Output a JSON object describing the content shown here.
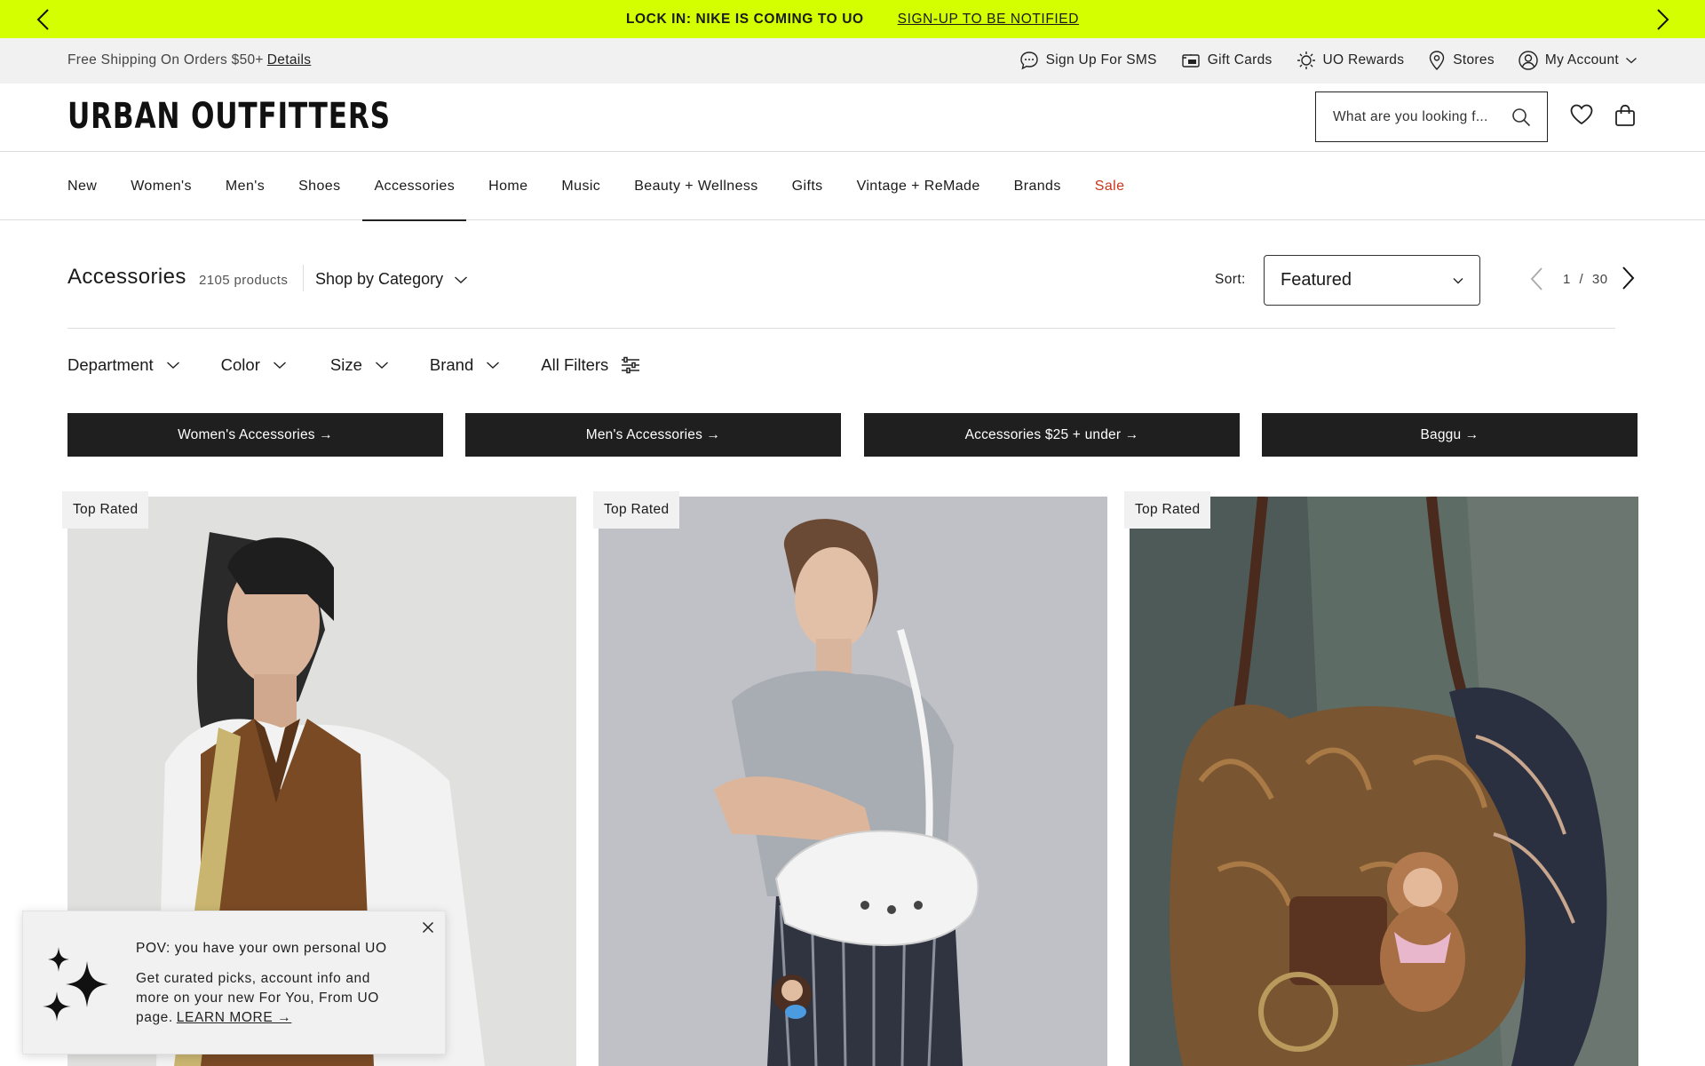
{
  "promo": {
    "text": "LOCK IN: NIKE IS COMING TO UO",
    "link": "SIGN-UP TO BE NOTIFIED",
    "bg_color": "#d4ff00"
  },
  "utility": {
    "shipping_text": "Free Shipping On Orders $50+",
    "shipping_link": "Details",
    "items": [
      {
        "label": "Sign Up For SMS",
        "icon": "chat-bubble-icon"
      },
      {
        "label": "Gift Cards",
        "icon": "gift-card-icon"
      },
      {
        "label": "UO Rewards",
        "icon": "sparkle-badge-icon"
      },
      {
        "label": "Stores",
        "icon": "location-pin-icon"
      },
      {
        "label": "My Account",
        "icon": "user-circle-icon"
      }
    ]
  },
  "header": {
    "logo": "URBAN OUTFITTERS",
    "search_placeholder": "What are you looking f..."
  },
  "nav": {
    "items": [
      "New",
      "Women's",
      "Men's",
      "Shoes",
      "Accessories",
      "Home",
      "Music",
      "Beauty + Wellness",
      "Gifts",
      "Vintage + ReMade",
      "Brands",
      "Sale"
    ],
    "active": "Accessories",
    "sale_color": "#c8371b"
  },
  "category": {
    "title": "Accessories",
    "count": "2105 products",
    "shop_by": "Shop by Category"
  },
  "sort": {
    "label": "Sort:",
    "selected": "Featured"
  },
  "pager": {
    "current": "1",
    "separator": "/",
    "total": "30"
  },
  "filters": [
    "Department",
    "Color",
    "Size",
    "Brand",
    "All Filters"
  ],
  "category_buttons": [
    "Women's Accessories →",
    "Men's Accessories →",
    "Accessories $25 + under →",
    "Baggu →"
  ],
  "products": [
    {
      "badge": "Top Rated"
    },
    {
      "badge": "Top Rated"
    },
    {
      "badge": "Top Rated"
    }
  ],
  "popup": {
    "title": "POV: you have your own personal UO",
    "body": "Get curated picks, account info and more on your new For You, From UO page.",
    "link": "LEARN MORE →"
  }
}
